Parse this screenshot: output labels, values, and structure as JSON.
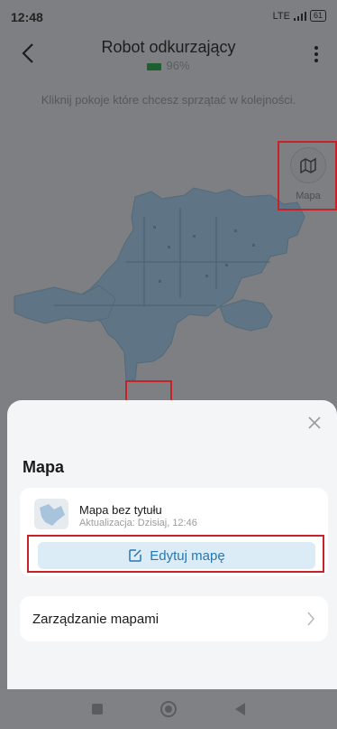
{
  "status": {
    "time": "12:48",
    "network": "LTE",
    "battery": "61"
  },
  "header": {
    "title": "Robot odkurzający",
    "battery_percent": "96%"
  },
  "instruction": "Kliknij pokoje które chcesz sprzątać w kolejności.",
  "map_toggle": {
    "label": "Mapa",
    "icon": "map-icon"
  },
  "sheet": {
    "title": "Mapa",
    "map_card": {
      "name": "Mapa bez tytułu",
      "updated": "Aktualizacja: Dzisiaj, 12:46",
      "edit_label": "Edytuj mapę",
      "edit_icon": "edit-icon"
    },
    "manage": {
      "label": "Zarządzanie mapami"
    }
  },
  "colors": {
    "accent": "#2677b3",
    "highlight": "#c7222a"
  }
}
